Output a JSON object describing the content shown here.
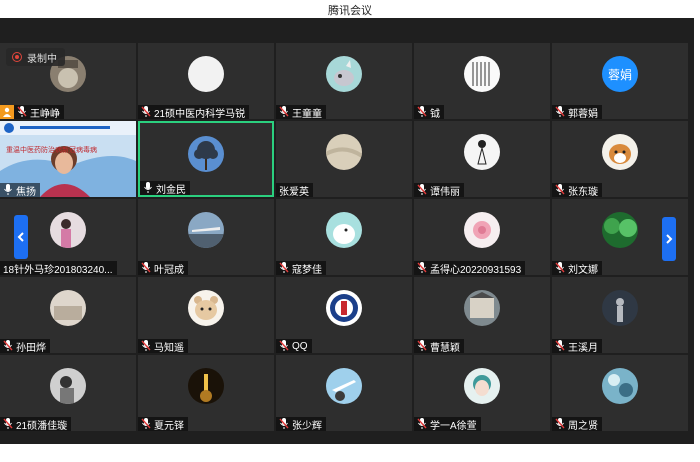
{
  "window": {
    "title": "腾讯会议"
  },
  "recording": {
    "label": "录制中"
  },
  "pager": {
    "prev": "‹",
    "next": "›"
  },
  "host_icon": "person-icon",
  "participants": [
    {
      "name": "王峥峥",
      "avatar": "cat-photo",
      "host": true
    },
    {
      "name": "21硕中医内科学马锐",
      "avatar": "white-circle"
    },
    {
      "name": "王童童",
      "avatar": "cartoon-rhino"
    },
    {
      "name": "钺",
      "avatar": "calligraphy"
    },
    {
      "name": "郭蓉娟",
      "avatar": "text",
      "avatar_text": "蓉娟",
      "avatar_color": "#1e90ff"
    },
    {
      "name": "焦扬",
      "avatar": "video",
      "video_caption": "重温中医药防治病新冠病毒病",
      "mic_on": true
    },
    {
      "name": "刘金民",
      "avatar": "tree-blue",
      "active": true,
      "mic_on": true
    },
    {
      "name": "张爱英",
      "avatar": "beige-cloth",
      "no_mic": true
    },
    {
      "name": "谭伟丽",
      "avatar": "ink-figure"
    },
    {
      "name": "张东璇",
      "avatar": "shiba-dog"
    },
    {
      "name": "18针外马珍201803240...",
      "avatar": "girl-photo",
      "no_mic": true
    },
    {
      "name": "叶冠成",
      "avatar": "airplane"
    },
    {
      "name": "寇梦佳",
      "avatar": "moomin"
    },
    {
      "name": "孟得心20220931593",
      "avatar": "pink-flower"
    },
    {
      "name": "刘文娜",
      "avatar": "green-forest"
    },
    {
      "name": "孙田烨",
      "avatar": "room-photo"
    },
    {
      "name": "马知遥",
      "avatar": "bear-cartoon"
    },
    {
      "name": "QQ",
      "avatar": "school-emblem"
    },
    {
      "name": "曹慧颖",
      "avatar": "building-photo"
    },
    {
      "name": "王溪月",
      "avatar": "dark-figure"
    },
    {
      "name": "21硕潘佳璇",
      "avatar": "stripe-photo"
    },
    {
      "name": "夏元铎",
      "avatar": "tower-night"
    },
    {
      "name": "张少辉",
      "avatar": "plane-sky"
    },
    {
      "name": "学一A徐萱",
      "avatar": "anime-girl"
    },
    {
      "name": "周之贤",
      "avatar": "blue-pattern"
    }
  ]
}
